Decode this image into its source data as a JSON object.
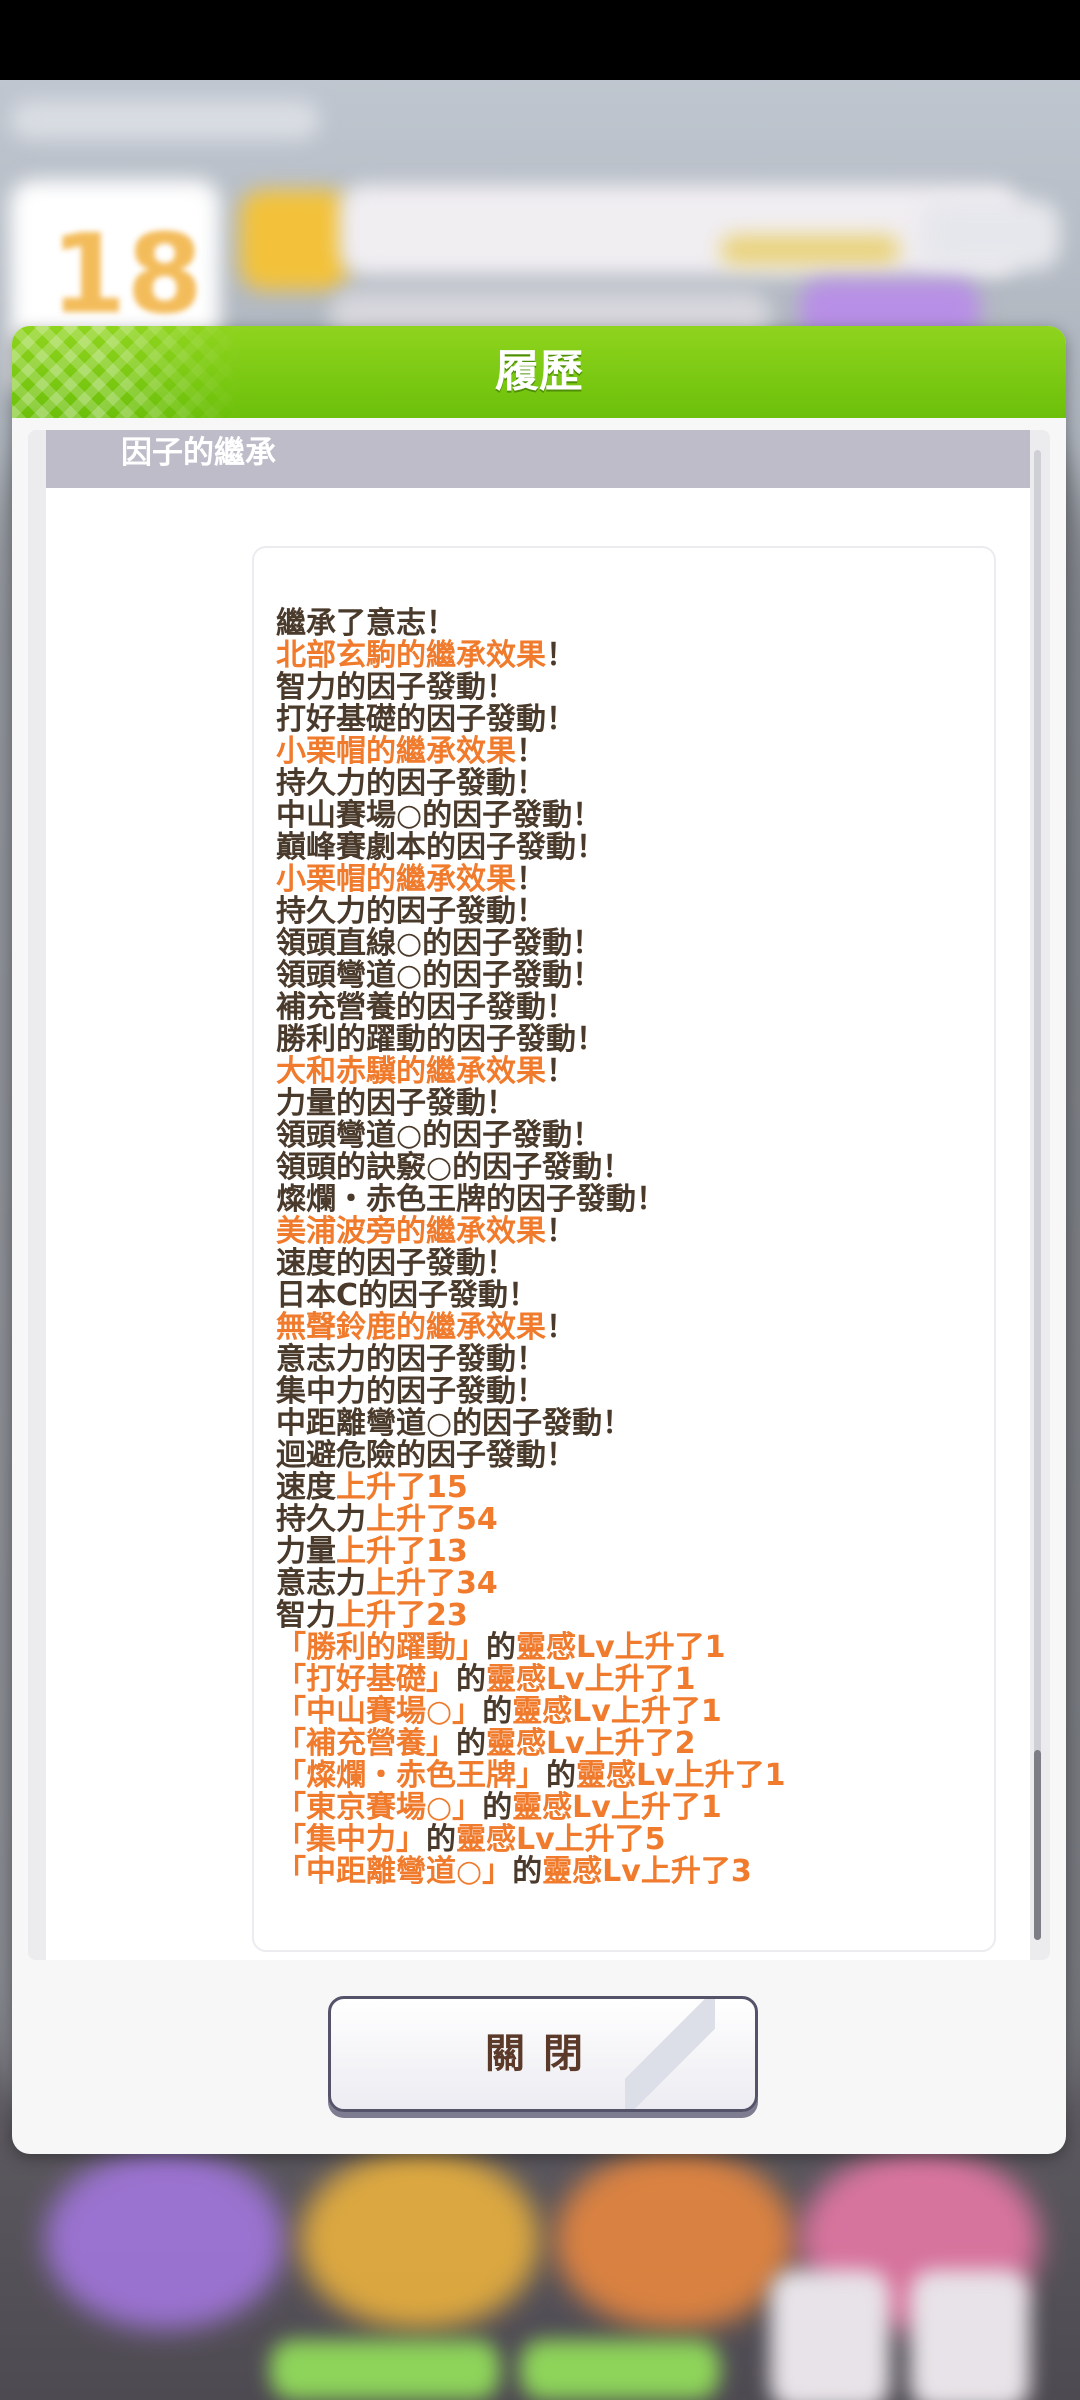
{
  "dialog": {
    "title": "履歷",
    "section_title": "因子的繼承",
    "close_label": "關閉"
  },
  "log_lines": [
    [
      {
        "t": "繼承了意志！",
        "c": "b"
      }
    ],
    [
      {
        "t": "北部玄駒的繼承效果",
        "c": "o"
      },
      {
        "t": "！",
        "c": "b"
      }
    ],
    [
      {
        "t": "智力的因子發動！",
        "c": "b"
      }
    ],
    [
      {
        "t": "打好基礎的因子發動！",
        "c": "b"
      }
    ],
    [
      {
        "t": "小栗帽的繼承效果",
        "c": "o"
      },
      {
        "t": "！",
        "c": "b"
      }
    ],
    [
      {
        "t": "持久力的因子發動！",
        "c": "b"
      }
    ],
    [
      {
        "t": "中山賽場○的因子發動！",
        "c": "b"
      }
    ],
    [
      {
        "t": "巔峰賽劇本的因子發動！",
        "c": "b"
      }
    ],
    [
      {
        "t": "小栗帽的繼承效果",
        "c": "o"
      },
      {
        "t": "！",
        "c": "b"
      }
    ],
    [
      {
        "t": "持久力的因子發動！",
        "c": "b"
      }
    ],
    [
      {
        "t": "領頭直線○的因子發動！",
        "c": "b"
      }
    ],
    [
      {
        "t": "領頭彎道○的因子發動！",
        "c": "b"
      }
    ],
    [
      {
        "t": "補充營養的因子發動！",
        "c": "b"
      }
    ],
    [
      {
        "t": "勝利的躍動的因子發動！",
        "c": "b"
      }
    ],
    [
      {
        "t": "大和赤驥的繼承效果",
        "c": "o"
      },
      {
        "t": "！",
        "c": "b"
      }
    ],
    [
      {
        "t": "力量的因子發動！",
        "c": "b"
      }
    ],
    [
      {
        "t": "領頭彎道○的因子發動！",
        "c": "b"
      }
    ],
    [
      {
        "t": "領頭的訣竅○的因子發動！",
        "c": "b"
      }
    ],
    [
      {
        "t": "燦爛・赤色王牌的因子發動！",
        "c": "b"
      }
    ],
    [
      {
        "t": "美浦波旁的繼承效果",
        "c": "o"
      },
      {
        "t": "！",
        "c": "b"
      }
    ],
    [
      {
        "t": "速度的因子發動！",
        "c": "b"
      }
    ],
    [
      {
        "t": "日本C的因子發動！",
        "c": "b"
      }
    ],
    [
      {
        "t": "無聲鈴鹿的繼承效果",
        "c": "o"
      },
      {
        "t": "！",
        "c": "b"
      }
    ],
    [
      {
        "t": "意志力的因子發動！",
        "c": "b"
      }
    ],
    [
      {
        "t": "集中力的因子發動！",
        "c": "b"
      }
    ],
    [
      {
        "t": "中距離彎道○的因子發動！",
        "c": "b"
      }
    ],
    [
      {
        "t": "迴避危險的因子發動！",
        "c": "b"
      }
    ],
    [
      {
        "t": "速度",
        "c": "b"
      },
      {
        "t": "上升了15",
        "c": "o"
      }
    ],
    [
      {
        "t": "持久力",
        "c": "b"
      },
      {
        "t": "上升了54",
        "c": "o"
      }
    ],
    [
      {
        "t": "力量",
        "c": "b"
      },
      {
        "t": "上升了13",
        "c": "o"
      }
    ],
    [
      {
        "t": "意志力",
        "c": "b"
      },
      {
        "t": "上升了34",
        "c": "o"
      }
    ],
    [
      {
        "t": "智力",
        "c": "b"
      },
      {
        "t": "上升了23",
        "c": "o"
      }
    ],
    [
      {
        "t": "「勝利的躍動」",
        "c": "o"
      },
      {
        "t": "的",
        "c": "b"
      },
      {
        "t": "靈感Lv上升了1",
        "c": "o"
      }
    ],
    [
      {
        "t": "「打好基礎」",
        "c": "o"
      },
      {
        "t": "的",
        "c": "b"
      },
      {
        "t": "靈感Lv上升了1",
        "c": "o"
      }
    ],
    [
      {
        "t": "「中山賽場○」",
        "c": "o"
      },
      {
        "t": "的",
        "c": "b"
      },
      {
        "t": "靈感Lv上升了1",
        "c": "o"
      }
    ],
    [
      {
        "t": "「補充營養」",
        "c": "o"
      },
      {
        "t": "的",
        "c": "b"
      },
      {
        "t": "靈感Lv上升了2",
        "c": "o"
      }
    ],
    [
      {
        "t": "「燦爛・赤色王牌」",
        "c": "o"
      },
      {
        "t": "的",
        "c": "b"
      },
      {
        "t": "靈感Lv上升了1",
        "c": "o"
      }
    ],
    [
      {
        "t": "「東京賽場○」",
        "c": "o"
      },
      {
        "t": "的",
        "c": "b"
      },
      {
        "t": "靈感Lv上升了1",
        "c": "o"
      }
    ],
    [
      {
        "t": "「集中力」",
        "c": "o"
      },
      {
        "t": "的",
        "c": "b"
      },
      {
        "t": "靈感Lv上升了5",
        "c": "o"
      }
    ],
    [
      {
        "t": "「中距離彎道○」",
        "c": "o"
      },
      {
        "t": "的",
        "c": "b"
      },
      {
        "t": "靈感Lv上升了3",
        "c": "o"
      }
    ]
  ],
  "colors": {
    "header_green": "#7ccb12",
    "highlight_orange": "#f07b2c",
    "text_brown": "#4a3a2b",
    "section_bar": "#bdbcc8"
  },
  "background": {
    "day_number": "18"
  }
}
